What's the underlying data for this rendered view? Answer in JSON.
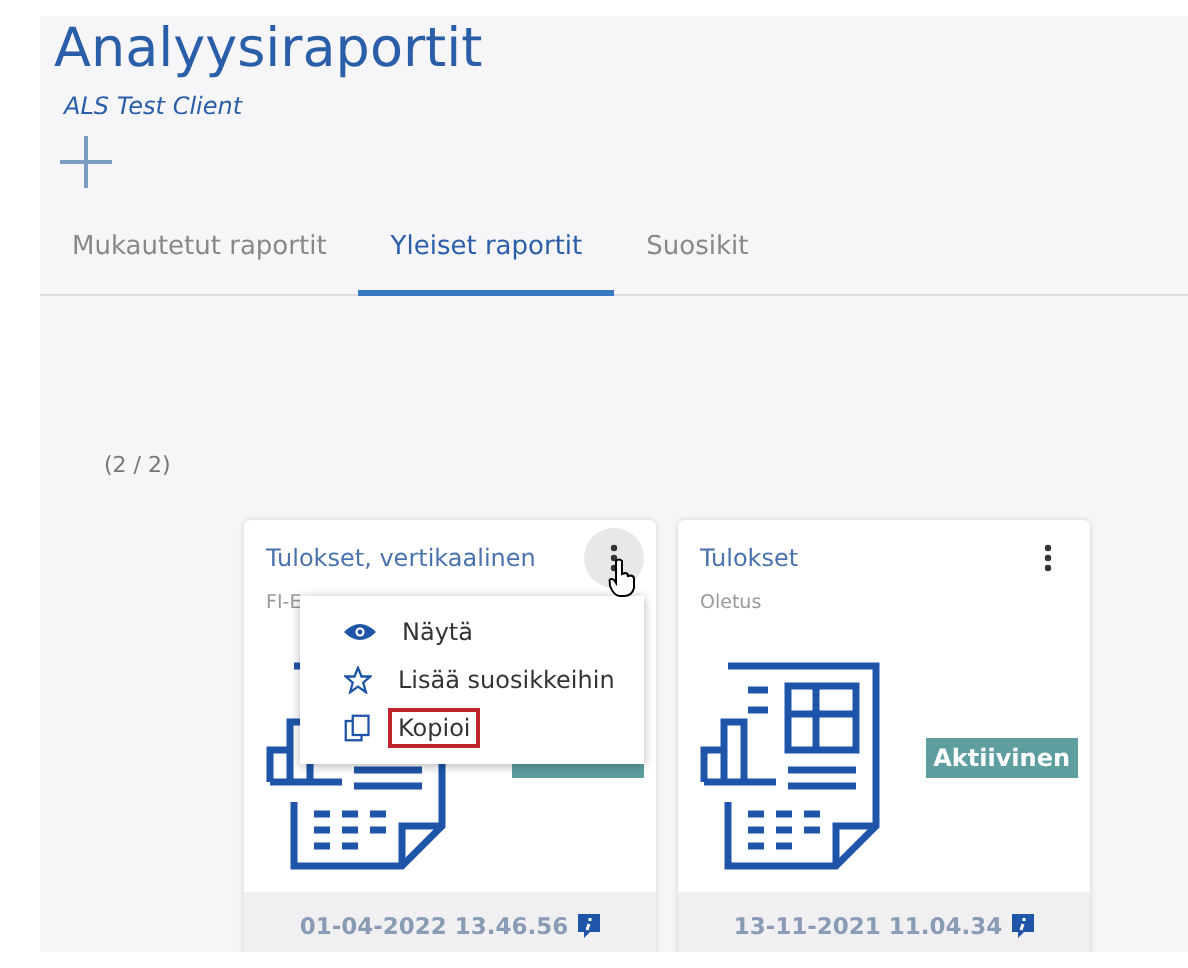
{
  "header": {
    "title": "Analyysiraportit",
    "client": "ALS Test Client"
  },
  "tabs": [
    {
      "label": "Mukautetut raportit",
      "selected": false
    },
    {
      "label": "Yleiset raportit",
      "selected": true
    },
    {
      "label": "Suosikit",
      "selected": false
    }
  ],
  "count": "(2 / 2)",
  "cards": [
    {
      "title": "Tulokset, vertikaalinen",
      "subtitle": "FI-E",
      "active": true,
      "menu_open": true,
      "date": "01-04-2022 13.46.56",
      "menu": [
        {
          "kind": "view",
          "label": "Näytä",
          "highlighted": false
        },
        {
          "kind": "favorite",
          "label": "Lisää suosikkeihin",
          "highlighted": false
        },
        {
          "kind": "copy",
          "label": "Kopioi",
          "highlighted": true
        }
      ]
    },
    {
      "title": "Tulokset",
      "subtitle": "Oletus",
      "active": true,
      "badge": "Aktiivinen",
      "menu_open": false,
      "date": "13-11-2021 11.04.34"
    }
  ]
}
